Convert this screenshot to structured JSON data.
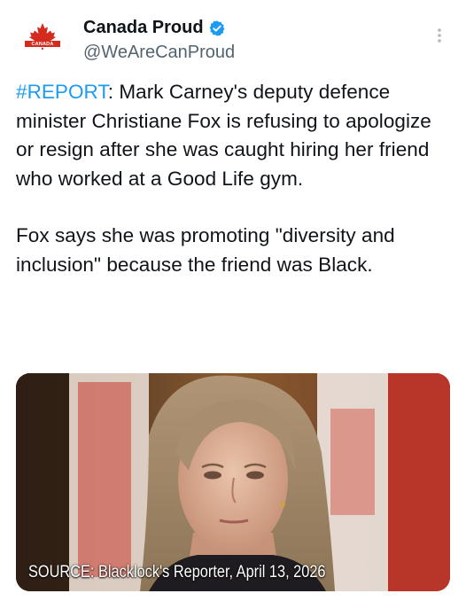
{
  "account": {
    "display_name": "Canada Proud",
    "handle": "@WeAreCanProud",
    "avatar_text": "CANADA PROUD",
    "verified": true
  },
  "tweet": {
    "hashtag": "#REPORT",
    "paragraph1_rest": ": Mark Carney's deputy defence minister Christiane Fox is refusing to apologize or resign after she was caught hiring her friend who worked at a Good Life gym.",
    "paragraph2": "Fox says she was promoting \"diversity and inclusion\" because the friend was Black."
  },
  "media": {
    "caption": "SOURCE: Blacklock's Reporter, April 13, 2026"
  },
  "colors": {
    "link": "#1d9bf0",
    "verified": "#1d9bf0",
    "handle": "#536471",
    "canada_red": "#d52b1e"
  },
  "icons": {
    "verified": "verified-badge-icon",
    "more": "more-options-icon",
    "avatar": "canada-flag-logo"
  }
}
